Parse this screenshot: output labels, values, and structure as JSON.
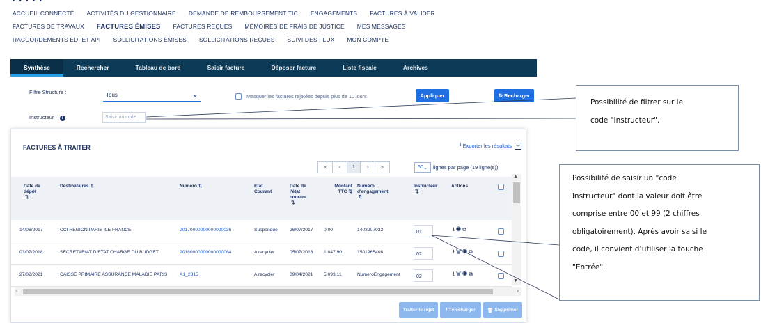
{
  "top_nav": {
    "row1": [
      "Accueil connecté",
      "Activités du gestionnaire",
      "Demande de remboursement TIC",
      "Engagements",
      "Factures à valider"
    ],
    "row2": [
      "Factures de travaux",
      "Factures émises",
      "Factures reçues",
      "Mémoires de frais de justice",
      "Mes messages"
    ],
    "row3": [
      "Raccordements EDI et API",
      "Sollicitations émises",
      "Sollicitations reçues",
      "Suivi des flux",
      "Mon compte"
    ],
    "active": "Factures émises"
  },
  "tabs": [
    "Synthèse",
    "Rechercher",
    "Tableau de bord",
    "Saisir facture",
    "Déposer facture",
    "Liste fiscale",
    "Archives"
  ],
  "active_tab": "Synthèse",
  "filters": {
    "structure_label": "Filtre Structure :",
    "structure_value": "Tous",
    "mask_label": "Masquer les factures rejetées depuis plus de 10 jours",
    "apply_label": "Appliquer",
    "reload_label": "Recharger",
    "instructeur_label": "Instructeur :",
    "instructeur_placeholder": "Saisir un code"
  },
  "panel": {
    "title": "Factures à traiter",
    "export_label": "Exporter les résultats",
    "pagination": {
      "first": "«",
      "prev": "‹",
      "current": "1",
      "next": "›",
      "last": "»"
    },
    "per_page_value": "50",
    "per_page_label": "lignes par page (19 ligne(s))"
  },
  "table": {
    "headers": {
      "date_depot": "Date de dépôt",
      "destinataires": "Destinataires",
      "numero": "Numéro",
      "etat": "Etat Courant",
      "date_etat": "Date de l'état courant",
      "montant": "Montant TTC",
      "engagement": "Numéro d'engagement",
      "instructeur": "Instructeur",
      "actions": "Actions"
    },
    "rows": [
      {
        "date_depot": "14/06/2017",
        "destinataire": "CCI REGION PARIS ILE FRANCE",
        "numero": "20170000000000000036",
        "etat": "Suspendue",
        "date_etat": "26/07/2017",
        "montant": "0,00",
        "engagement": "1403207032",
        "instructeur": "01"
      },
      {
        "date_depot": "03/07/2018",
        "destinataire": "SECRETARIAT D ETAT CHARGE DU BUDGET",
        "numero": "20180000000000000064",
        "etat": "A recycler",
        "date_etat": "05/07/2018",
        "montant": "1 047,90",
        "engagement": "1501965408",
        "instructeur": "02"
      },
      {
        "date_depot": "27/02/2021",
        "destinataire": "CAISSE PRIMAIRE ASSURANCE MALADIE PARIS",
        "numero": "A1_2315",
        "etat": "A recycler",
        "date_etat": "09/04/2021",
        "montant": "5 093,11",
        "engagement": "NumeroEngagement",
        "instructeur": "02"
      }
    ]
  },
  "footer_buttons": {
    "reject": "Traiter le rejet",
    "download": "Télécharger",
    "delete": "Supprimer"
  },
  "callouts": {
    "filter": [
      "Possibilité de filtrer sur le",
      "code \"Instructeur\"."
    ],
    "input": [
      "Possibilité de saisir un \"code",
      "instructeur\" dont la valeur doit être",
      "comprise entre 00 et 99 (2 chiffres",
      "obligatoirement). Après avoir saisi le",
      "code, il convient d’utiliser la touche",
      "\"Entrée\"."
    ]
  },
  "colors": {
    "tab_bar": "#0d3b57",
    "accent": "#1f6fe0",
    "text": "#1f3464",
    "tab_active_underline": "#2a9fe3"
  }
}
